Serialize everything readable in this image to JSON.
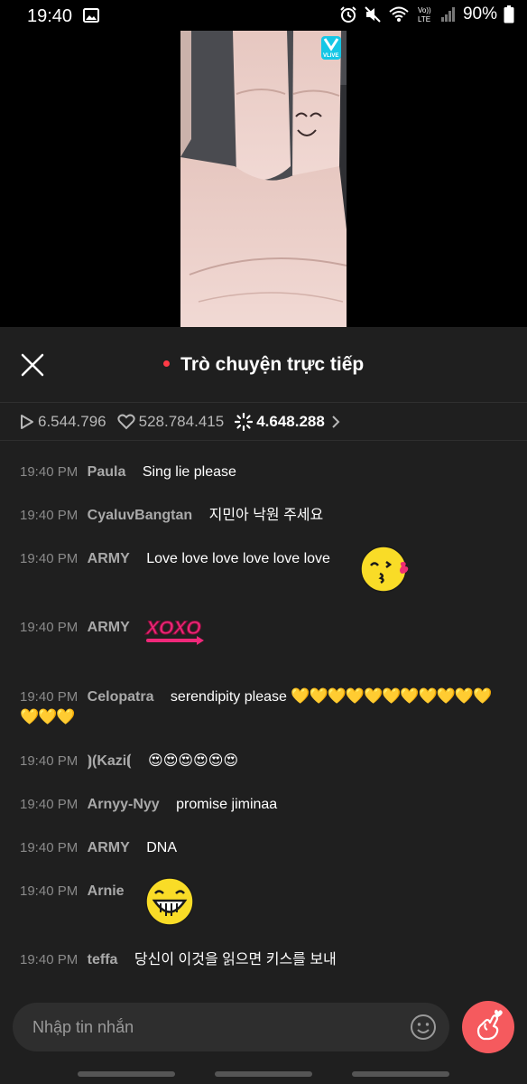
{
  "status_bar": {
    "time": "19:40",
    "battery": "90%",
    "icons": [
      "gallery-icon",
      "alarm-icon",
      "mute-icon",
      "wifi-icon",
      "volte-icon",
      "signal-icon",
      "battery-icon"
    ],
    "volte_label": "Vo)) LTE"
  },
  "video": {
    "logo": "V LIVE",
    "logo_color": "#16c7e6"
  },
  "chat": {
    "title": "Trò chuyện trực tiếp",
    "live_color": "#ff3b46",
    "stats": {
      "plays": "6.544.796",
      "likes": "528.784.415",
      "stickers": "4.648.288"
    },
    "messages": [
      {
        "time": "19:40 PM",
        "user": "Paula",
        "text": "Sing lie please"
      },
      {
        "time": "19:40 PM",
        "user": "CyaluvBangtan",
        "text": "지민아 낙원 주세요"
      },
      {
        "time": "19:40 PM",
        "user": "ARMY",
        "text": "Love love love love love love",
        "sticker": "kiss-emoji-sticker"
      },
      {
        "time": "19:40 PM",
        "user": "ARMY",
        "text": "",
        "sticker": "xoxo-sticker",
        "sticker_text": "XOXO"
      },
      {
        "time": "19:40 PM",
        "user": "Celopatra",
        "text": "serendipity please",
        "hearts": "💛💛💛💛💛💛💛💛💛💛💛",
        "hearts_line2": "💛💛💛"
      },
      {
        "time": "19:40 PM",
        "user": "⦘(Kazi⦗",
        "text": "😍😍😍😍😍😍"
      },
      {
        "time": "19:40 PM",
        "user": "Arnyy-Nyy",
        "text": "promise jiminaa"
      },
      {
        "time": "19:40 PM",
        "user": "ARMY",
        "text": "DNA"
      },
      {
        "time": "19:40 PM",
        "user": "Arnie",
        "text": "",
        "sticker": "grin-emoji-sticker"
      },
      {
        "time": "19:40 PM",
        "user": "teffa",
        "text": "당신이 이것을 읽으면 키스를 보내"
      }
    ]
  },
  "input": {
    "placeholder": "Nhập tin nhắn",
    "send_heart_color": "#f55a5e"
  }
}
